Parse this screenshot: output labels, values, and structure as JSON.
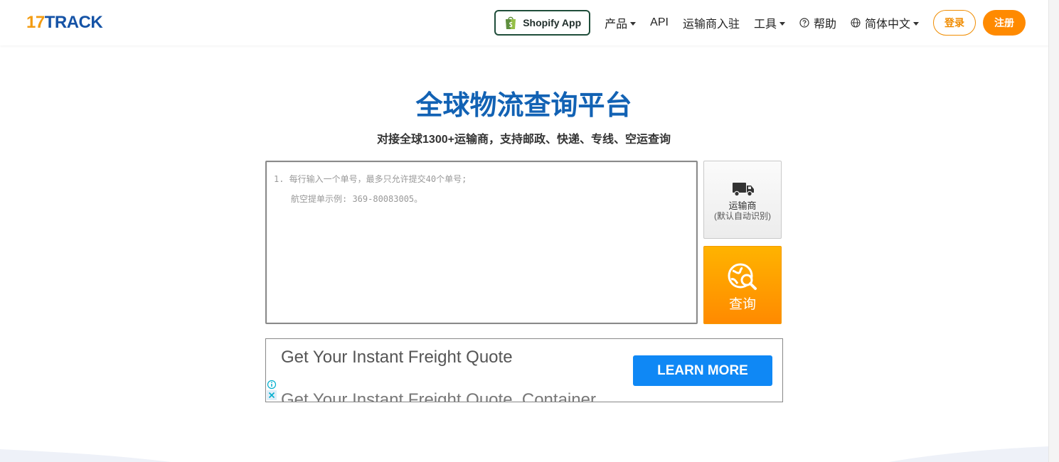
{
  "header": {
    "logo_num": "17",
    "logo_word": "TRACK",
    "shopify_label": "Shopify App",
    "nav": {
      "products": "产品",
      "api": "API",
      "carrier_join": "运输商入驻",
      "tools": "工具",
      "help": "帮助",
      "language": "简体中文"
    },
    "login": "登录",
    "register": "注册"
  },
  "hero": {
    "title": "全球物流查询平台",
    "subtitle": "对接全球1300+运输商，支持邮政、快递、专线、空运查询"
  },
  "tracking": {
    "placeholder_line1": "1. 每行输入一个单号，最多只允许提交40个单号;",
    "placeholder_line2": "航空提单示例: 369-80083005。",
    "carrier_label": "运输商",
    "carrier_sub": "(默认自动识别)",
    "search_label": "查询"
  },
  "ad": {
    "headline": "Get Your Instant Freight Quote",
    "description": "Get Your Instant Freight Quote, Container",
    "cta": "LEARN MORE"
  },
  "colors": {
    "brand_blue": "#1262b4",
    "brand_orange": "#ff8a00",
    "ad_blue": "#0f88f5"
  }
}
